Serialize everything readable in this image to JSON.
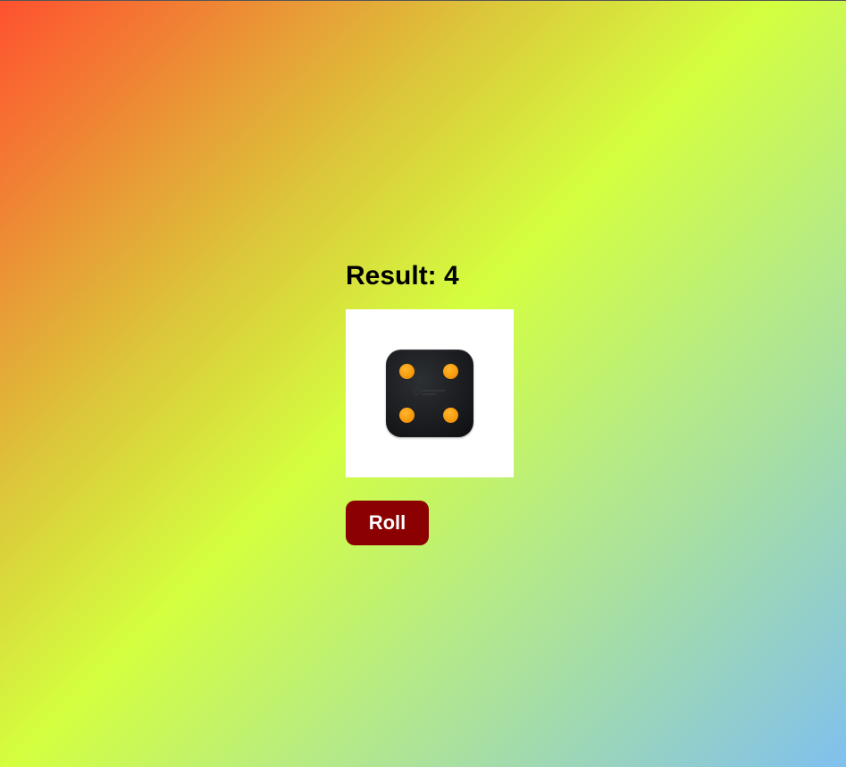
{
  "result": {
    "label": "Result:",
    "value": "4"
  },
  "dice": {
    "face": 4,
    "body_color": "#1b1d20",
    "pip_color": "#f79a0b"
  },
  "roll_button": {
    "label": "Roll",
    "color": "#8b0000"
  }
}
